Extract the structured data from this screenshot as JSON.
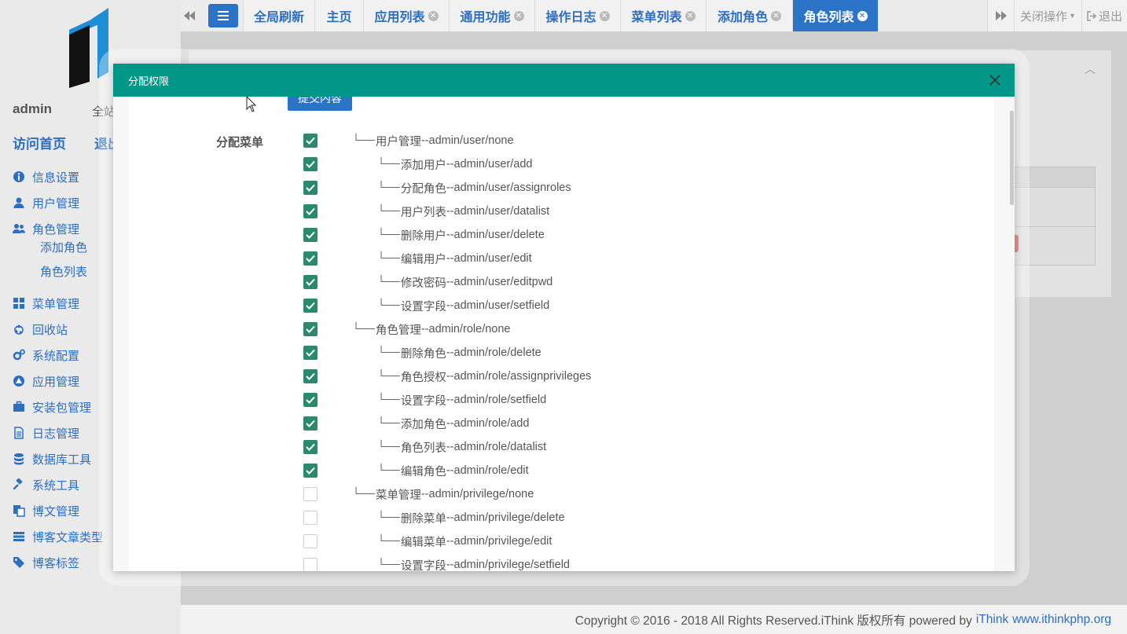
{
  "sidebar": {
    "user_name": "admin",
    "site_label": "全站",
    "visit_home": "访问首页",
    "logout": "退出",
    "items": [
      {
        "label": "信息设置",
        "icon": "info-circle-icon"
      },
      {
        "label": "用户管理",
        "icon": "user-icon"
      },
      {
        "label": "角色管理",
        "icon": "users-icon"
      },
      {
        "label": "菜单管理",
        "icon": "grid-icon"
      },
      {
        "label": "回收站",
        "icon": "recycle-icon"
      },
      {
        "label": "系统配置",
        "icon": "cogs-icon"
      },
      {
        "label": "应用管理",
        "icon": "app-icon"
      },
      {
        "label": "安装包管理",
        "icon": "briefcase-icon"
      },
      {
        "label": "日志管理",
        "icon": "file-icon"
      },
      {
        "label": "数据库工具",
        "icon": "database-icon"
      },
      {
        "label": "系统工具",
        "icon": "gavel-icon"
      },
      {
        "label": "博文管理",
        "icon": "copy-icon"
      },
      {
        "label": "博客文章类型",
        "icon": "list-icon"
      },
      {
        "label": "博客标签",
        "icon": "tags-icon"
      }
    ],
    "sub_items": [
      "添加角色",
      "角色列表"
    ]
  },
  "topbar": {
    "tabs": [
      {
        "label": "全局刷新",
        "closable": false
      },
      {
        "label": "主页",
        "closable": false
      },
      {
        "label": "应用列表",
        "closable": true
      },
      {
        "label": "通用功能",
        "closable": true
      },
      {
        "label": "操作日志",
        "closable": true
      },
      {
        "label": "菜单列表",
        "closable": true
      },
      {
        "label": "添加角色",
        "closable": true
      },
      {
        "label": "角色列表",
        "closable": true,
        "active": true
      }
    ],
    "close_ops": "关闭操作",
    "logout": "退出",
    "close_glyph": "✕",
    "accent_color": "#2a73c6"
  },
  "modal": {
    "title": "分配权限",
    "submit_label": "提交内容",
    "assign_label": "分配菜单",
    "header_color": "#009688",
    "privileges": [
      {
        "name": "用户管理",
        "path": "admin/user/none",
        "level": 1,
        "checked": true
      },
      {
        "name": "添加用户",
        "path": "admin/user/add",
        "level": 2,
        "checked": true
      },
      {
        "name": "分配角色",
        "path": "admin/user/assignroles",
        "level": 2,
        "checked": true
      },
      {
        "name": "用户列表",
        "path": "admin/user/datalist",
        "level": 2,
        "checked": true
      },
      {
        "name": "删除用户",
        "path": "admin/user/delete",
        "level": 2,
        "checked": true
      },
      {
        "name": "编辑用户",
        "path": "admin/user/edit",
        "level": 2,
        "checked": true
      },
      {
        "name": "修改密码",
        "path": "admin/user/editpwd",
        "level": 2,
        "checked": true
      },
      {
        "name": "设置字段",
        "path": "admin/user/setfield",
        "level": 2,
        "checked": true
      },
      {
        "name": "角色管理",
        "path": "admin/role/none",
        "level": 1,
        "checked": true
      },
      {
        "name": "删除角色",
        "path": "admin/role/delete",
        "level": 2,
        "checked": true
      },
      {
        "name": "角色授权",
        "path": "admin/role/assignprivileges",
        "level": 2,
        "checked": true
      },
      {
        "name": "设置字段",
        "path": "admin/role/setfield",
        "level": 2,
        "checked": true
      },
      {
        "name": "添加角色",
        "path": "admin/role/add",
        "level": 2,
        "checked": true
      },
      {
        "name": "角色列表",
        "path": "admin/role/datalist",
        "level": 2,
        "checked": true
      },
      {
        "name": "编辑角色",
        "path": "admin/role/edit",
        "level": 2,
        "checked": true
      },
      {
        "name": "菜单管理",
        "path": "admin/privilege/none",
        "level": 1,
        "checked": false
      },
      {
        "name": "删除菜单",
        "path": "admin/privilege/delete",
        "level": 2,
        "checked": false
      },
      {
        "name": "编辑菜单",
        "path": "admin/privilege/edit",
        "level": 2,
        "checked": false
      },
      {
        "name": "设置字段",
        "path": "admin/privilege/setfield",
        "level": 2,
        "checked": false
      }
    ]
  },
  "footer": {
    "copyright": "Copyright © 2016 - 2018 All Rights Reserved.iThink 版权所有 powered by",
    "brand": "iThink",
    "site": "www.ithinkphp.org"
  }
}
